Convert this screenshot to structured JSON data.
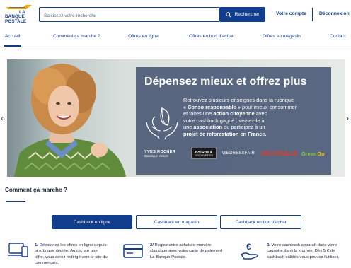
{
  "header": {
    "logo_line1": "LA",
    "logo_line2": "BANQUE",
    "logo_line3": "POSTALE",
    "search_placeholder": "Saisissez votre recherche",
    "search_button": "Rechercher",
    "account": "Votre compte",
    "logout": "Déconnexion",
    "colors": {
      "primary": "#123c8c",
      "accent": "#f6a800"
    }
  },
  "nav": {
    "items": [
      {
        "label": "Accueil"
      },
      {
        "label": "Comment ça marche ?"
      },
      {
        "label": "Offres en ligne"
      },
      {
        "label": "Offres en bon d'achat"
      },
      {
        "label": "Offres en magasin"
      },
      {
        "label": "Contact"
      }
    ]
  },
  "banner": {
    "title": "Dépensez mieux et offrez plus",
    "text_1": "Retrouvez plusieurs enseignes dans la rubrique",
    "text_2_bold": "« Conso responsable »",
    "text_2": " pour mieux consommer",
    "text_3": "et faites une ",
    "text_3_bold": "action citoyenne",
    "text_3_end": " avec",
    "text_4": "votre cashback gagné : versez-le à",
    "text_5": "une ",
    "text_5_bold": "association",
    "text_5_end": " ou participez à un",
    "text_6_bold": "projet de reforestation en France.",
    "brands": [
      "YVES ROCHER",
      "Botanique Vivante",
      "NATURE &",
      "DÉCOUVERTES",
      "WEDRESSFAIR",
      "NATURALIA",
      "Green",
      "Go"
    ],
    "prev_arrow": "‹",
    "next_arrow": "›"
  },
  "how": {
    "title": "Comment ça marche ?",
    "tabs": [
      {
        "label": "Cashback en ligne"
      },
      {
        "label": "Cashback en magasin"
      },
      {
        "label": "Cashback en bon d'achat"
      }
    ],
    "steps": [
      {
        "num": "1/",
        "text_a": " Découvrez les offres en ligne depuis",
        "text_b": "la rubrique dédiée. Au clic sur une",
        "text_c": "offre, vous serez redirigé vers le site du",
        "text_d": "commerçant.",
        "icon": "devices-icon"
      },
      {
        "num": "2/",
        "text_a": " Réglez votre achat de manière",
        "text_b": "classique avec votre carte de paiement",
        "text_c": "La Banque Postale.",
        "text_d": "",
        "icon": "card-icon"
      },
      {
        "num": "3/",
        "text_a": " Votre cashback apparaît dans votre",
        "text_b": "cagnotte dans la journée. Dès 5 € de",
        "text_c": "cashback validés vous pouvez l'utiliser.",
        "text_d": "",
        "icon": "euro-hand-icon"
      }
    ]
  }
}
